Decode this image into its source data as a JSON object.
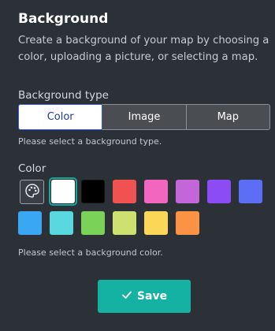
{
  "panel": {
    "title": "Background",
    "description": "Create a background of your map by choosing a color, uploading a picture, or selecting a map."
  },
  "background_type": {
    "label": "Background type",
    "options": [
      "Color",
      "Image",
      "Map"
    ],
    "selected": "Color",
    "hint": "Please select a background type."
  },
  "color": {
    "label": "Color",
    "palette_icon": "palette-icon",
    "selected": "#ffffff",
    "swatches": [
      "#ffffff",
      "#000000",
      "#f05252",
      "#f266c0",
      "#c366d9",
      "#8b4cf5",
      "#5b6ef5",
      "#3aa7f5",
      "#5ad8df",
      "#7ad358",
      "#cde070",
      "#fcd757",
      "#fb9244"
    ],
    "hint": "Please select a background color."
  },
  "actions": {
    "save_label": "Save",
    "save_icon": "check-icon",
    "accent": "#14b2a3"
  }
}
